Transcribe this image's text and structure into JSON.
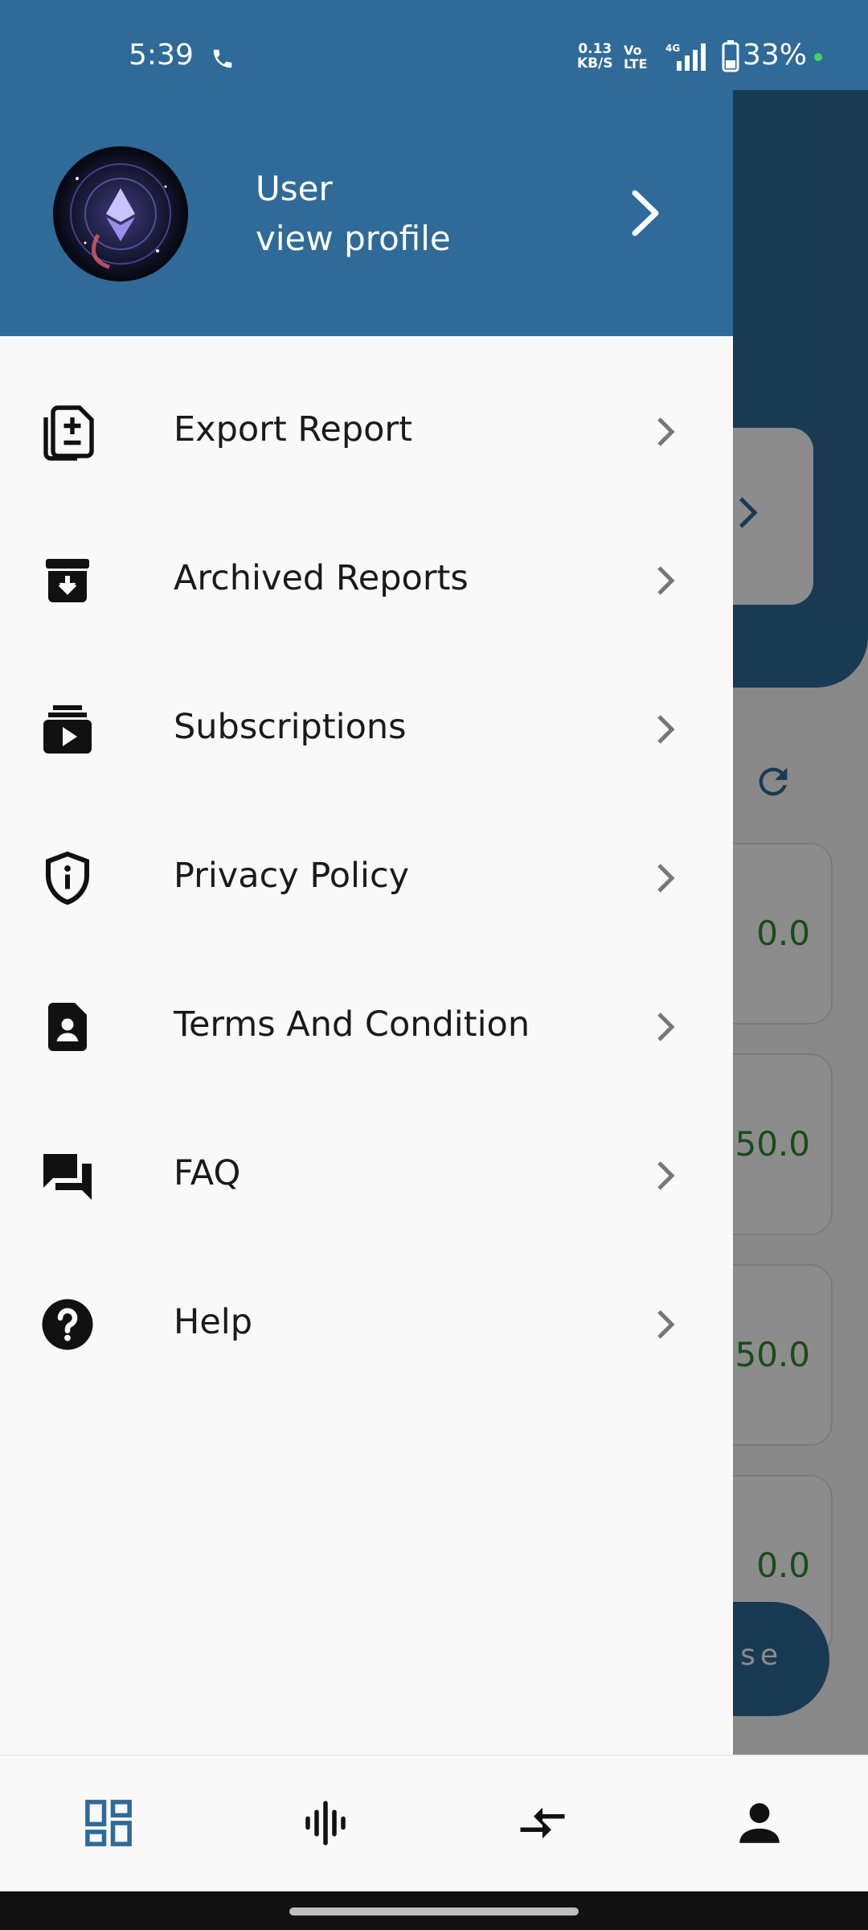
{
  "status_bar": {
    "time": "5:39",
    "net_speed_value": "0.13",
    "net_speed_unit": "KB/S",
    "volte_top": "Vo",
    "volte_bottom": "LTE",
    "signal_label": "4G",
    "battery": "33%"
  },
  "drawer": {
    "header": {
      "user_name": "User",
      "view_profile": "view profile"
    },
    "items": [
      {
        "label": "Export Report",
        "icon": "export-report-icon"
      },
      {
        "label": "Archived Reports",
        "icon": "archive-icon"
      },
      {
        "label": "Subscriptions",
        "icon": "subscriptions-icon"
      },
      {
        "label": "Privacy Policy",
        "icon": "privacy-shield-icon"
      },
      {
        "label": "Terms And Condition",
        "icon": "terms-document-icon"
      },
      {
        "label": "FAQ",
        "icon": "faq-chat-icon"
      },
      {
        "label": "Help",
        "icon": "help-icon"
      }
    ]
  },
  "background": {
    "stat_values": [
      "0.0",
      "50.0",
      "50.0",
      "0.0"
    ],
    "fab_label": "nse"
  },
  "bottom_nav": [
    {
      "icon": "dashboard-icon",
      "active": true
    },
    {
      "icon": "waveform-icon",
      "active": false
    },
    {
      "icon": "transfer-icon",
      "active": false
    },
    {
      "icon": "person-icon",
      "active": false
    }
  ],
  "colors": {
    "primary": "#2f6a98",
    "drawer_bg": "#f9f9f9",
    "positive": "#2f8a2f"
  }
}
